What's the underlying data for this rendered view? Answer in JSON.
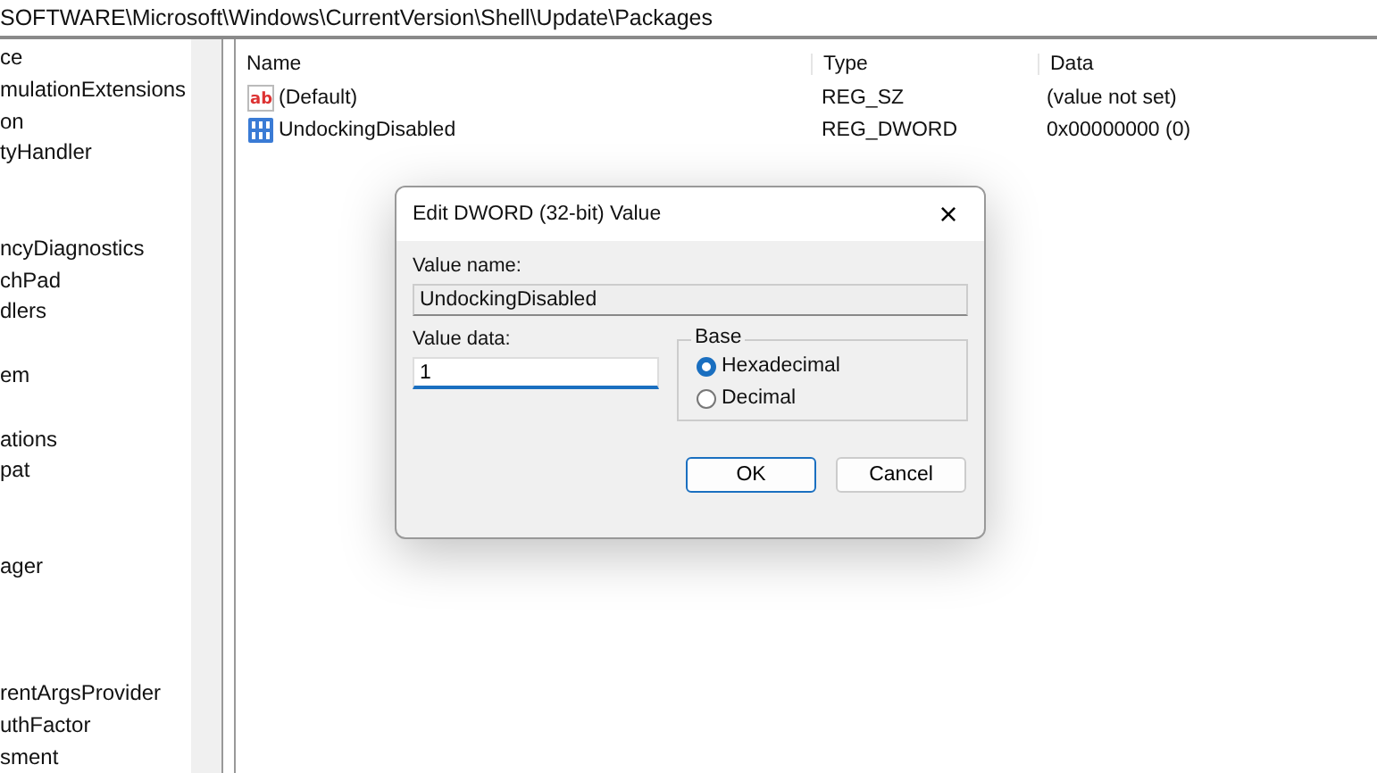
{
  "address_bar": {
    "path": "SOFTWARE\\Microsoft\\Windows\\CurrentVersion\\Shell\\Update\\Packages"
  },
  "tree": {
    "items": [
      {
        "label": "ce"
      },
      {
        "label": "mulationExtensions"
      },
      {
        "label": "on"
      },
      {
        "label": "tyHandler"
      },
      {
        "label": "ncyDiagnostics"
      },
      {
        "label": "chPad"
      },
      {
        "label": "dlers"
      },
      {
        "label": "em"
      },
      {
        "label": "ations"
      },
      {
        "label": "pat"
      },
      {
        "label": "ager"
      },
      {
        "label": "rentArgsProvider"
      },
      {
        "label": "uthFactor"
      },
      {
        "label": "sment"
      }
    ]
  },
  "values_list": {
    "columns": [
      "Name",
      "Type",
      "Data"
    ],
    "rows": [
      {
        "kind": "string",
        "icon_text": "ab",
        "name": "(Default)",
        "type": "REG_SZ",
        "data": "(value not set)"
      },
      {
        "kind": "binary",
        "name": "UndockingDisabled",
        "type": "REG_DWORD",
        "data": "0x00000000 (0)"
      }
    ]
  },
  "dialog": {
    "title": "Edit DWORD (32-bit) Value",
    "close": "×",
    "value_name_label": "Value name:",
    "value_name": "UndockingDisabled",
    "value_data_label": "Value data:",
    "value_data": "1",
    "base_label": "Base",
    "base_options": [
      {
        "label": "Hexadecimal",
        "selected": true
      },
      {
        "label": "Decimal",
        "selected": false
      }
    ],
    "buttons": [
      {
        "label": "OK",
        "default": true
      },
      {
        "label": "Cancel",
        "default": false
      }
    ]
  }
}
